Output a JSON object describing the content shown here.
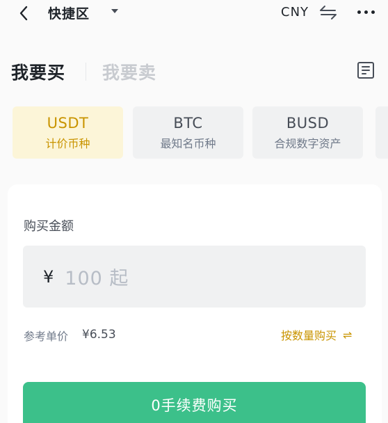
{
  "header": {
    "title": "快捷区",
    "currency": "CNY"
  },
  "tabs": {
    "buy": "我要买",
    "sell": "我要卖"
  },
  "coins": [
    {
      "symbol": "USDT",
      "desc": "计价币种",
      "active": true
    },
    {
      "symbol": "BTC",
      "desc": "最知名币种",
      "active": false
    },
    {
      "symbol": "BUSD",
      "desc": "合规数字资产",
      "active": false
    }
  ],
  "form": {
    "amount_label": "购买金额",
    "currency_symbol": "¥",
    "amount_placeholder": "100 起",
    "reference_label": "参考单价",
    "reference_price": "¥6.53",
    "by_quantity_label": "按数量购买",
    "buy_button": "0手续费购买"
  },
  "colors": {
    "accent": "#c99400",
    "active_card_bg": "#fcf5d8",
    "buy_green": "#3cc08a"
  },
  "icons": {
    "back": "chevron-left-icon",
    "dropdown": "caret-down-icon",
    "swap": "swap-arrows-icon",
    "more": "more-dots-icon",
    "orders": "order-list-icon"
  }
}
